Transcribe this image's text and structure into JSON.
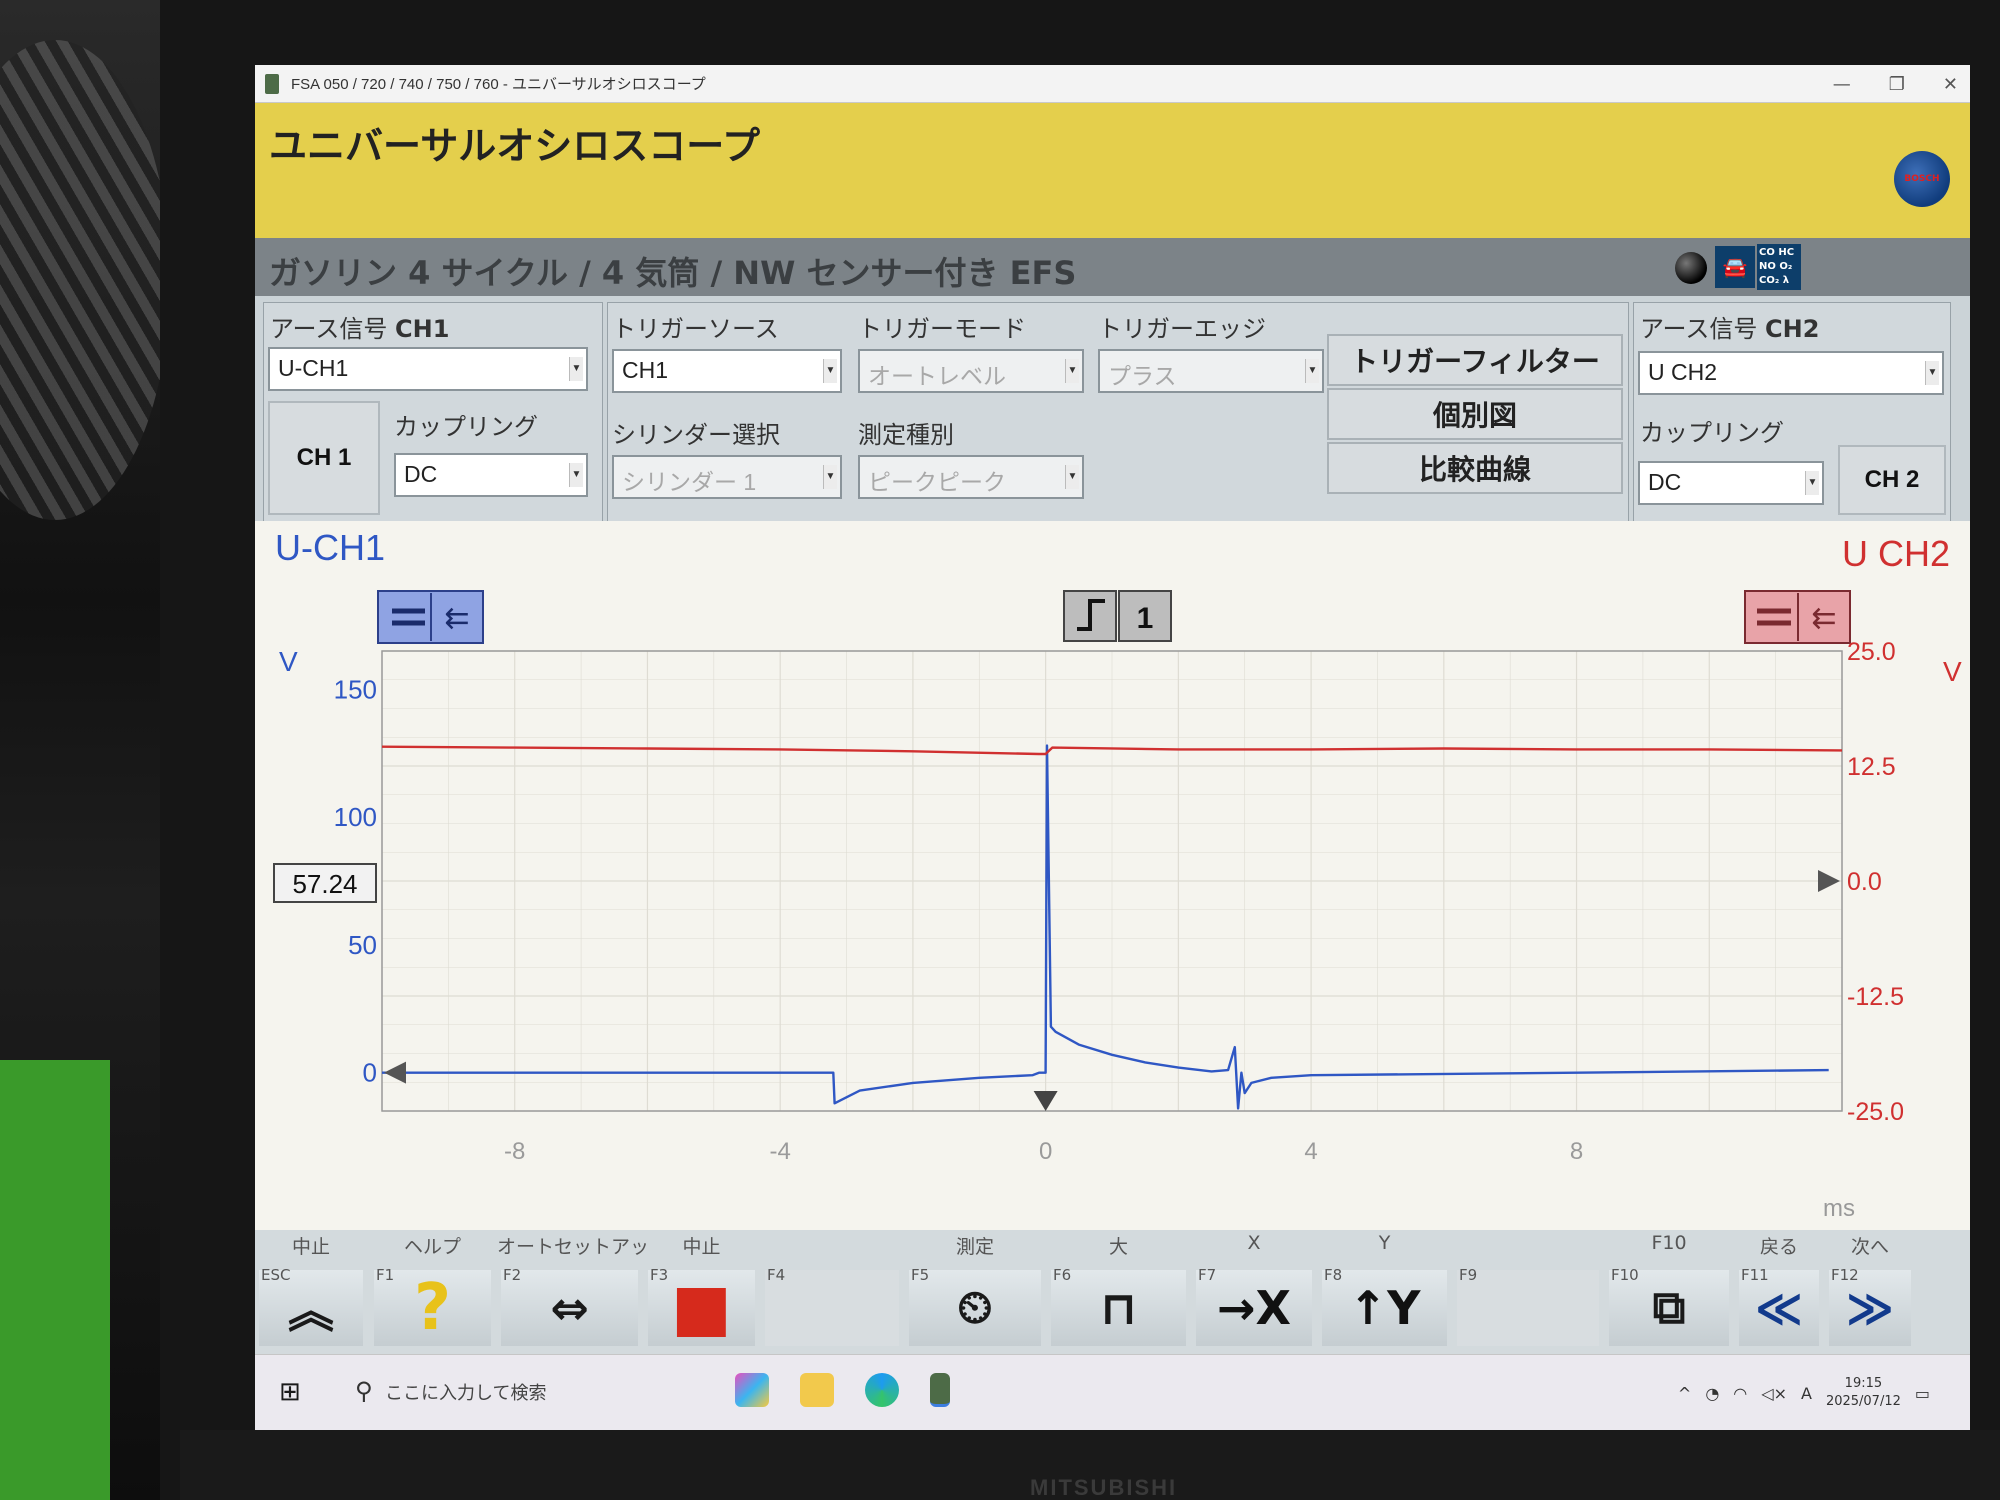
{
  "window": {
    "title": "FSA 050 / 720 / 740 / 750 / 760 - ユニバーサルオシロスコープ",
    "minimize": "—",
    "restore": "❐",
    "close": "✕"
  },
  "header": {
    "app_title": "ユニバーサルオシロスコープ",
    "logo_text": "BOSCH"
  },
  "subtitle": {
    "text": "ガソリン 4 サイクル / 4 気筒 / NW センサー付き EFS",
    "gas_labels": [
      "CO HC",
      "NO O₂",
      "CO₂ λ"
    ],
    "car_glyph": "🚘"
  },
  "ch1_group": {
    "label": "アース信号",
    "label_suffix": "CH1",
    "channel_value": "U-CH1",
    "button": "CH 1",
    "coupling_label": "カップリング",
    "coupling_value": "DC"
  },
  "trigger_group": {
    "source_label": "トリガーソース",
    "source_value": "CH1",
    "mode_label": "トリガーモード",
    "mode_value": "オートレベル",
    "edge_label": "トリガーエッジ",
    "edge_value": "プラス",
    "cylinder_label": "シリンダー選択",
    "cylinder_value": "シリンダー 1",
    "measure_label": "測定種別",
    "measure_value": "ピークピーク",
    "filter_button": "トリガーフィルター",
    "individual_button": "個別図",
    "compare_button": "比較曲線"
  },
  "ch2_group": {
    "label": "アース信号",
    "label_suffix": "CH2",
    "channel_value": "U CH2",
    "coupling_label": "カップリング",
    "coupling_value": "DC",
    "button": "CH 2"
  },
  "scope": {
    "ch1_name": "U-CH1",
    "ch2_name": "U CH2",
    "ch1_unit": "V",
    "ch2_unit": "V",
    "x_unit": "ms",
    "cursor_value": "57.24",
    "trigger_channel": "1",
    "colors": {
      "ch1": "#2f57c4",
      "ch2": "#d03030",
      "grid": "#dedcd3"
    }
  },
  "chart_data": {
    "type": "line",
    "x_ticks": [
      -8,
      -4,
      0,
      4,
      8
    ],
    "xlim": [
      -10,
      12
    ],
    "y_left_ticks": [
      0,
      50,
      100,
      150
    ],
    "ylim_left": [
      -15,
      165
    ],
    "y_right_ticks": [
      25.0,
      12.5,
      0.0,
      -12.5,
      -25.0
    ],
    "y_right_tick_labels": [
      "25.0",
      "12.5",
      "0.0",
      "-12.5",
      "-25.0"
    ],
    "ylim_right": [
      -25,
      25
    ],
    "grid": true,
    "series": [
      {
        "name": "U-CH1",
        "axis": "left",
        "x": [
          -10,
          -4,
          -3.2,
          -3.18,
          -2.8,
          -2.0,
          -1.0,
          -0.2,
          -0.1,
          0,
          0.02,
          0.08,
          0.15,
          0.5,
          1,
          1.5,
          2.0,
          2.5,
          2.75,
          2.85,
          2.9,
          2.95,
          3.0,
          3.1,
          3.4,
          4,
          8,
          11.8
        ],
        "y": [
          0,
          0,
          0,
          -12,
          -7,
          -4,
          -2,
          -1,
          0,
          0,
          128,
          18,
          16,
          11,
          7,
          4,
          2,
          0.5,
          1,
          10,
          -14,
          0,
          -8,
          -4,
          -2,
          -1,
          0,
          1
        ]
      },
      {
        "name": "U CH2",
        "axis": "right",
        "x": [
          -10,
          -8,
          -6,
          -4,
          -2,
          -0.1,
          0,
          0.1,
          2,
          4,
          6,
          8,
          10,
          12
        ],
        "y": [
          14.6,
          14.5,
          14.4,
          14.3,
          14.1,
          13.8,
          13.8,
          14.5,
          14.3,
          14.3,
          14.4,
          14.3,
          14.3,
          14.2
        ]
      }
    ]
  },
  "fkeys": [
    {
      "caption": "中止",
      "key": "ESC",
      "glyph": "︽",
      "disabled": false
    },
    {
      "caption": "ヘルプ",
      "key": "F1",
      "glyph": "?",
      "disabled": false
    },
    {
      "caption": "オートセットアッ",
      "key": "F2",
      "glyph": "⇔",
      "disabled": false
    },
    {
      "caption": "中止",
      "key": "F3",
      "glyph": "■",
      "disabled": false
    },
    {
      "caption": "",
      "key": "F4",
      "glyph": "",
      "disabled": true
    },
    {
      "caption": "測定",
      "key": "F5",
      "glyph": "⏲",
      "disabled": false
    },
    {
      "caption": "大",
      "key": "F6",
      "glyph": "⊓",
      "disabled": false
    },
    {
      "caption": "X",
      "key": "F7",
      "glyph": "→X",
      "disabled": false
    },
    {
      "caption": "Y",
      "key": "F8",
      "glyph": "↑Y",
      "disabled": false
    },
    {
      "caption": "",
      "key": "F9",
      "glyph": "",
      "disabled": true
    },
    {
      "caption": "F10",
      "key": "F10",
      "glyph": "⧉",
      "disabled": false
    },
    {
      "caption": "戻る",
      "key": "F11",
      "glyph": "≪",
      "disabled": false
    },
    {
      "caption": "次へ",
      "key": "F12",
      "glyph": "≫",
      "disabled": false
    }
  ],
  "taskbar": {
    "start_glyph": "⊞",
    "search_glyph": "⚲",
    "search_placeholder": "ここに入力して検索",
    "tray_ime": "A",
    "clock_time": "19:15",
    "clock_date": "2025/07/12"
  },
  "monitor": {
    "brand": "MITSUBISHI"
  }
}
